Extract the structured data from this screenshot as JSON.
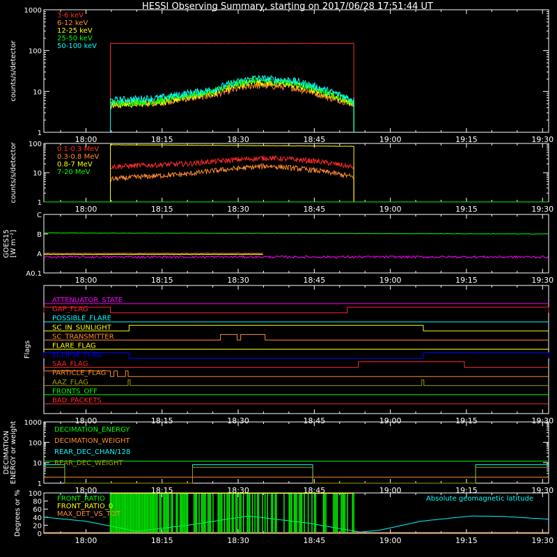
{
  "title": "HESSI Observing Summary, starting on 2017/06/28 17:51:44 UT",
  "time_axis": {
    "tick_labels": [
      "18:00",
      "18:15",
      "18:30",
      "18:45",
      "19:00",
      "19:15",
      "19:30"
    ],
    "tick_minutes": [
      0,
      15,
      30,
      45,
      60,
      75,
      90
    ],
    "range_minutes": [
      -8.3,
      91.2
    ]
  },
  "colors": {
    "red": "#ff2a2a",
    "orange": "#ff8c2a",
    "yellow": "#ffff00",
    "green": "#00ff00",
    "cyan": "#00ffff",
    "magenta": "#ff00ff",
    "blue": "#0000ff",
    "olive": "#a0a000",
    "axis": "#ffffff"
  },
  "chart_data": [
    {
      "id": "low-energy",
      "type": "line",
      "ylabel": "counts/s/detector",
      "yscale": "log",
      "ylim": [
        1,
        1000
      ],
      "ytick_labels": [
        "1",
        "10",
        "100",
        "1000"
      ],
      "ytick_values": [
        1,
        10,
        100,
        1000
      ],
      "legend": [
        {
          "name": "3-6 keV",
          "color": "red"
        },
        {
          "name": "6-12 keV",
          "color": "orange"
        },
        {
          "name": "12-25 keV",
          "color": "yellow"
        },
        {
          "name": "25-50 keV",
          "color": "green"
        },
        {
          "name": "50-100 keV",
          "color": "cyan"
        }
      ],
      "series": [
        {
          "name": "3-6 keV",
          "color": "red",
          "start": 4.8,
          "end": 52.8,
          "x": [
            4.8,
            15,
            30,
            45,
            52.8
          ],
          "y": [
            150,
            150,
            150,
            150,
            150
          ]
        },
        {
          "name": "6-12 keV",
          "color": "orange",
          "start": 4.8,
          "end": 52.8,
          "x": [
            4.8,
            15,
            25,
            33,
            40,
            48,
            52.8
          ],
          "y": [
            5,
            5.5,
            8,
            14,
            13,
            7,
            5
          ]
        },
        {
          "name": "12-25 keV",
          "color": "yellow",
          "start": 4.8,
          "end": 52.8,
          "x": [
            4.8,
            15,
            25,
            33,
            40,
            48,
            52.8
          ],
          "y": [
            4.5,
            5.5,
            9,
            17,
            15,
            8,
            5
          ]
        },
        {
          "name": "25-50 keV",
          "color": "green",
          "start": 4.8,
          "end": 52.8,
          "x": [
            4.8,
            15,
            25,
            33,
            40,
            48,
            52.8
          ],
          "y": [
            5,
            6,
            10,
            19,
            17,
            9,
            5
          ]
        },
        {
          "name": "50-100 keV",
          "color": "cyan",
          "start": 4.8,
          "end": 52.8,
          "x": [
            4.8,
            15,
            25,
            33,
            40,
            48,
            52.8
          ],
          "y": [
            6,
            7,
            11,
            21,
            19,
            10,
            6
          ]
        }
      ]
    },
    {
      "id": "high-energy",
      "type": "line",
      "ylabel": "counts/s/detector",
      "yscale": "log",
      "ylim": [
        1,
        100
      ],
      "ytick_labels": [
        "1",
        "10",
        "100"
      ],
      "ytick_values": [
        1,
        10,
        100
      ],
      "legend": [
        {
          "name": "0.1-0.3 MeV",
          "color": "red"
        },
        {
          "name": "0.3-0.8 MeV",
          "color": "orange"
        },
        {
          "name": "0.8-7 MeV",
          "color": "yellow"
        },
        {
          "name": "7-20 MeV",
          "color": "green"
        }
      ],
      "series": [
        {
          "name": "0.1-0.3 MeV",
          "color": "red",
          "start": 4.8,
          "end": 52.8,
          "x": [
            4.8,
            20,
            30,
            36,
            45,
            52.8
          ],
          "y": [
            16,
            20,
            28,
            32,
            25,
            15
          ]
        },
        {
          "name": "0.3-0.8 MeV",
          "color": "orange",
          "start": 4.8,
          "end": 52.8,
          "x": [
            4.8,
            20,
            30,
            36,
            45,
            52.8
          ],
          "y": [
            6,
            9,
            14,
            17,
            12,
            7
          ]
        },
        {
          "name": "0.8-7 MeV",
          "color": "yellow",
          "start": 4.8,
          "end": 52.8,
          "x": [
            4.8,
            30,
            52.8
          ],
          "y": [
            90,
            85,
            80
          ]
        },
        {
          "name": "7-20 MeV",
          "color": "green",
          "start": -8.3,
          "end": 91.2,
          "x": [
            -8.3,
            91.2
          ],
          "y": [
            1,
            1
          ]
        }
      ]
    },
    {
      "id": "goes",
      "type": "line",
      "ylabel": "GOES15",
      "ylabel_unit": "[W m⁻²]",
      "ytick_labels": [
        "A0.1",
        "A",
        "B",
        "C"
      ],
      "ylim": [
        0,
        3
      ],
      "series": [
        {
          "name": "goes-long",
          "color": "green",
          "start": -8.3,
          "end": 91.2,
          "x": [
            -8.3,
            91.2
          ],
          "y": [
            2.05,
            2.0
          ]
        },
        {
          "name": "goes-short",
          "color": "magenta",
          "start": -8.3,
          "end": 91.2,
          "x": [
            -8.3,
            91.2
          ],
          "y": [
            0.82,
            0.82
          ]
        },
        {
          "name": "goes-orange",
          "color": "orange",
          "start": -8.3,
          "end": 35,
          "x": [
            -8.3,
            35
          ],
          "y": [
            1.0,
            1.0
          ]
        },
        {
          "name": "goes-yellow",
          "color": "yellow",
          "start": -8.3,
          "end": 35,
          "x": [
            -8.3,
            35
          ],
          "y": [
            0.95,
            0.95
          ]
        }
      ]
    },
    {
      "id": "flags",
      "type": "line",
      "ylabel": "Flags",
      "flags": [
        {
          "name": "ATTENUATOR_STATE",
          "color": "magenta",
          "segments": []
        },
        {
          "name": "GAP_FLAG",
          "color": "red",
          "segments": [
            [
              -8.3,
              4.8
            ],
            [
              51.5,
              91.2
            ]
          ]
        },
        {
          "name": "POSSIBLE_FLARE",
          "color": "cyan",
          "segments": []
        },
        {
          "name": "SC_IN_SUNLIGHT",
          "color": "yellow",
          "segments": [
            [
              8.5,
              66.5
            ]
          ]
        },
        {
          "name": "SC_TRANSMITTER",
          "color": "orange",
          "segments": [
            [
              26.5,
              29.8
            ],
            [
              30.5,
              35.3
            ]
          ]
        },
        {
          "name": "FLARE_FLAG",
          "color": "yellow",
          "segments": []
        },
        {
          "name": "ECLIPSE_FLAG",
          "color": "blue",
          "segments": [
            [
              -8.3,
              8.5
            ],
            [
              66.5,
              91.2
            ]
          ]
        },
        {
          "name": "SAA_FLAG",
          "color": "red",
          "segments": [
            [
              53.7,
              74.6
            ]
          ]
        },
        {
          "name": "PARTICLE_FLAG",
          "color": "orange",
          "segments": [
            [
              -8.3,
              4.8
            ],
            [
              5.5,
              6.2
            ],
            [
              7.8,
              8.3
            ]
          ]
        },
        {
          "name": "AAZ_FLAG",
          "color": "olive",
          "segments": [
            [
              8.3,
              8.7
            ],
            [
              66.2,
              66.6
            ]
          ]
        },
        {
          "name": "FRONTS_OFF",
          "color": "green",
          "segments": []
        },
        {
          "name": "BAD_PACKETS",
          "color": "red",
          "segments": []
        }
      ]
    },
    {
      "id": "decimation",
      "type": "line",
      "ylabel": "DECIMATION ENERGY or weight",
      "yscale": "log",
      "ylim": [
        1,
        1000
      ],
      "ytick_labels": [
        "1",
        "10",
        "100",
        "1000"
      ],
      "ytick_values": [
        1,
        10,
        100,
        1000
      ],
      "legend": [
        {
          "name": "DECIMATION_ENERGY",
          "color": "green"
        },
        {
          "name": "DECIMATION_WEIGHT",
          "color": "orange"
        },
        {
          "name": "REAR_DEC_CHAN/128",
          "color": "cyan"
        },
        {
          "name": "REAR_DEC_WEIGHT",
          "color": "olive"
        }
      ],
      "series": [
        {
          "name": "DECIMATION_ENERGY",
          "color": "green",
          "x": [
            -8.3,
            91.2
          ],
          "y": [
            12,
            12
          ]
        },
        {
          "name": "DECIMATION_WEIGHT",
          "color": "orange",
          "x": [
            -8.3,
            91.2
          ],
          "y": [
            2,
            2
          ]
        },
        {
          "name": "REAR_DEC_CHAN/128",
          "color": "cyan",
          "x": [
            -8.3,
            -4.2,
            -4.2,
            21,
            21,
            44.7,
            44.7,
            76.8,
            76.8,
            91.2
          ],
          "y": [
            8,
            8,
            1,
            1,
            8,
            8,
            1,
            1,
            8,
            8
          ]
        },
        {
          "name": "REAR_DEC_WEIGHT",
          "color": "olive",
          "x": [
            -8.3,
            -4.2,
            -4.2,
            21,
            21,
            44.7,
            44.7,
            76.8,
            76.8,
            91.2
          ],
          "y": [
            6,
            6,
            1,
            1,
            6,
            6,
            1,
            1,
            6,
            6
          ]
        }
      ]
    },
    {
      "id": "ratios",
      "type": "line",
      "ylabel": "Degrees or %",
      "ylim": [
        0,
        100
      ],
      "ytick_labels": [
        "0",
        "20",
        "40",
        "60",
        "80",
        "100"
      ],
      "ytick_values": [
        0,
        20,
        40,
        60,
        80,
        100
      ],
      "annotation": "Absolute geomagnetic latitude",
      "legend": [
        {
          "name": "FRONT_RATIO",
          "color": "green"
        },
        {
          "name": "FRONT_RATIO_0",
          "color": "yellow"
        },
        {
          "name": "MAX_DET_VS_TOT",
          "color": "orange"
        }
      ],
      "series": [
        {
          "name": "Absolute geomagnetic latitude",
          "color": "cyan",
          "x": [
            -8.3,
            0,
            10,
            20,
            32,
            44,
            54,
            58,
            66,
            76,
            82,
            91.2
          ],
          "y": [
            40,
            30,
            5,
            20,
            43,
            25,
            3,
            8,
            30,
            43,
            42,
            35
          ]
        },
        {
          "name": "FRONT_RATIO",
          "color": "green",
          "start": 4.8,
          "end": 52.8
        },
        {
          "name": "MAX_DET_VS_TOT",
          "color": "orange",
          "x": [
            -8.3,
            91.2
          ],
          "y": [
            2,
            2
          ]
        }
      ]
    }
  ]
}
